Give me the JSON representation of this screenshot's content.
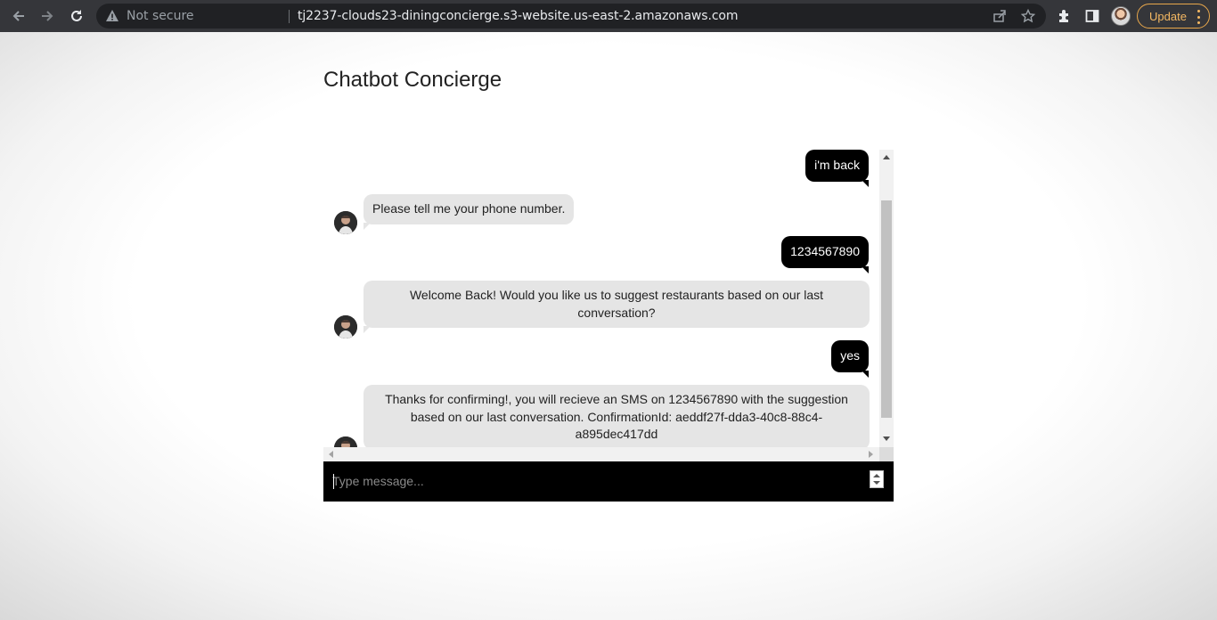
{
  "browser": {
    "security_label": "Not secure",
    "url": "tj2237-clouds23-diningconcierge.s3-website.us-east-2.amazonaws.com",
    "update_label": "Update"
  },
  "page": {
    "title": "Chatbot Concierge"
  },
  "chat": {
    "messages": [
      {
        "sender": "user",
        "text": "i'm back"
      },
      {
        "sender": "bot",
        "text": "Please tell me your phone number."
      },
      {
        "sender": "user",
        "text": "1234567890"
      },
      {
        "sender": "bot",
        "text": "Welcome Back! Would you like us to suggest restaurants based on our last conversation?"
      },
      {
        "sender": "user",
        "text": "yes"
      },
      {
        "sender": "bot",
        "text": "Thanks for confirming!, you will recieve an SMS on 1234567890 with the suggestion based on our last conversation. ConfirmationId: aeddf27f-dda3-40c8-88c4-a895dec417dd"
      }
    ],
    "input_placeholder": "Type message..."
  },
  "colors": {
    "toolbar": "#35363a",
    "user_bubble": "#000000",
    "bot_bubble": "#e5e5e5",
    "update_accent": "#f5b963"
  }
}
